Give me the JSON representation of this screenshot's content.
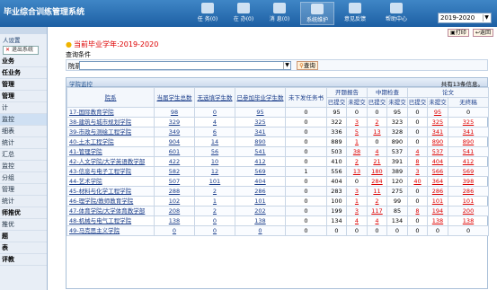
{
  "app": {
    "title": "毕业综合训练管理系统"
  },
  "nav": [
    {
      "label": "任 务(0)"
    },
    {
      "label": "在 办(0)"
    },
    {
      "label": "消 息(0)"
    },
    {
      "label": "系统维护"
    },
    {
      "label": "意见反馈"
    },
    {
      "label": "帮助中心"
    }
  ],
  "year_select": {
    "value": "2019-2020"
  },
  "sidebar": {
    "user_label": "人设置",
    "logout_label": "退出系统",
    "items": [
      {
        "label": "业务"
      },
      {
        "label": "任业务"
      },
      {
        "label": "管理"
      },
      {
        "label": "管理"
      },
      {
        "label": "计"
      },
      {
        "label": "监控"
      },
      {
        "label": "细表"
      },
      {
        "label": "统计"
      },
      {
        "label": "汇总"
      },
      {
        "label": "监控"
      },
      {
        "label": "分组"
      },
      {
        "label": "管理"
      },
      {
        "label": "统计"
      },
      {
        "label": "师推优"
      },
      {
        "label": "推优"
      },
      {
        "label": "题"
      },
      {
        "label": "表"
      },
      {
        "label": "评教"
      }
    ]
  },
  "toolbar": {
    "print_label": "打印",
    "back_label": "返回"
  },
  "heading": "当前毕业学年:2019-2020",
  "query": {
    "title": "查询条件",
    "dept_label": "院系",
    "search_label": "查询"
  },
  "panel": {
    "title": "学院监控",
    "total_text": "共有13条信息。"
  },
  "table": {
    "headers": {
      "dept": "院系",
      "students": "当届学生总数",
      "no_task": "无选填学生数",
      "registered": "已参加毕业学生数",
      "not_sent": "未下发任务书",
      "opening": "开题报告",
      "midterm": "中期检查",
      "thesis": "论文",
      "submitted": "已提交",
      "not_submitted": "未提交",
      "no_draft": "无终稿"
    },
    "rows": [
      {
        "dept": "17-国际教育学院",
        "c": [
          "98",
          "0",
          "95",
          "0",
          "95",
          "0",
          "0",
          "95",
          "0",
          "95",
          "0"
        ]
      },
      {
        "dept": "38-建筑与城市规划学院",
        "c": [
          "329",
          "4",
          "325",
          "0",
          "322",
          "3",
          "2",
          "323",
          "0",
          "325",
          "325"
        ]
      },
      {
        "dept": "39-市政与测绘工程学院",
        "c": [
          "349",
          "6",
          "341",
          "0",
          "336",
          "5",
          "13",
          "328",
          "0",
          "341",
          "341"
        ]
      },
      {
        "dept": "40-土木工程学院",
        "c": [
          "904",
          "14",
          "890",
          "0",
          "889",
          "1",
          "0",
          "890",
          "0",
          "890",
          "890"
        ]
      },
      {
        "dept": "41-管理学院",
        "c": [
          "601",
          "56",
          "541",
          "0",
          "503",
          "38",
          "4",
          "537",
          "4",
          "537",
          "541"
        ]
      },
      {
        "dept": "42-人文学院/大学英语教学部",
        "c": [
          "422",
          "10",
          "412",
          "0",
          "410",
          "2",
          "21",
          "391",
          "8",
          "404",
          "412"
        ]
      },
      {
        "dept": "43-信息与电子工程学院",
        "c": [
          "582",
          "12",
          "569",
          "1",
          "556",
          "13",
          "180",
          "389",
          "3",
          "566",
          "569"
        ]
      },
      {
        "dept": "44-艺术学院",
        "c": [
          "507",
          "101",
          "404",
          "0",
          "404",
          "0",
          "284",
          "120",
          "40",
          "364",
          "398"
        ]
      },
      {
        "dept": "45-材料与化学工程学院",
        "c": [
          "288",
          "2",
          "286",
          "0",
          "283",
          "3",
          "11",
          "275",
          "0",
          "286",
          "286"
        ]
      },
      {
        "dept": "46-理学院/教师教育学院",
        "c": [
          "102",
          "1",
          "101",
          "0",
          "100",
          "1",
          "2",
          "99",
          "0",
          "101",
          "101"
        ]
      },
      {
        "dept": "47-体育学院/大学体育教学部",
        "c": [
          "208",
          "2",
          "202",
          "0",
          "199",
          "3",
          "117",
          "85",
          "8",
          "194",
          "200"
        ]
      },
      {
        "dept": "48-机械与电气工程学院",
        "c": [
          "138",
          "0",
          "138",
          "0",
          "134",
          "4",
          "4",
          "134",
          "0",
          "138",
          "138"
        ]
      },
      {
        "dept": "49-马克思主义学院",
        "c": [
          "0",
          "0",
          "0",
          "0",
          "0",
          "0",
          "0",
          "0",
          "0",
          "0",
          "0"
        ]
      }
    ]
  }
}
